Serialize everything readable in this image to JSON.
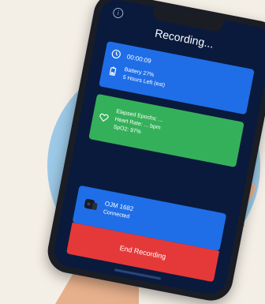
{
  "screen": {
    "title": "Recording...",
    "info_icon": "info-icon"
  },
  "status_card": {
    "timer": "00:00:09",
    "battery": "Battery 27%",
    "time_left": "5 Hours Left (est)"
  },
  "stats_card": {
    "line1": "Elapsed Epochs: ...",
    "line2": "Heart Rate: ... bpm",
    "line3": "SpO2: 97%"
  },
  "device_card": {
    "name": "OJM 1682",
    "status": "Connected"
  },
  "actions": {
    "end_label": "End Recording"
  },
  "colors": {
    "background": "#f4efe6",
    "circle": "#9cc9e6",
    "screen": "#0a1a3d",
    "blue_card": "#1f6ee8",
    "green_card": "#35b05a",
    "end_button": "#e53939"
  }
}
